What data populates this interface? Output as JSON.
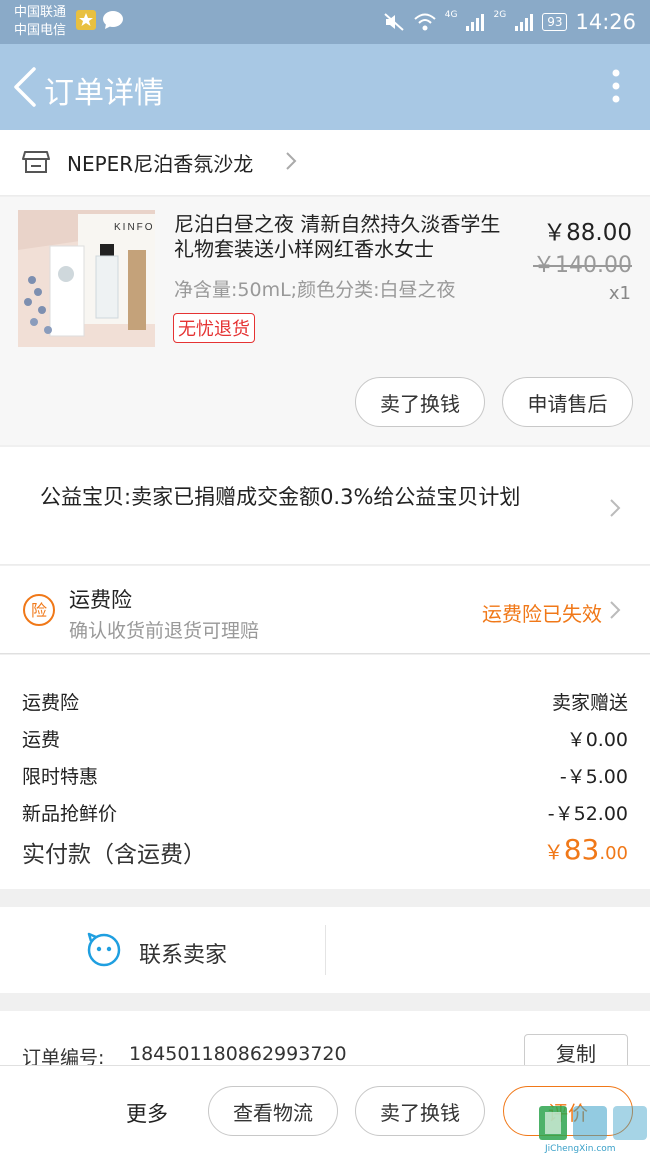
{
  "status_bar": {
    "carrier_1": "中国联通",
    "carrier_2": "中国电信",
    "network_1": "4G",
    "network_2": "2G",
    "battery": "93",
    "time": "14:26"
  },
  "nav": {
    "title": "订单详情"
  },
  "shop": {
    "name": "NEPER尼泊香氛沙龙"
  },
  "item": {
    "title": "尼泊白昼之夜 清新自然持久淡香学生礼物套装送小样网红香水女士",
    "spec": "净含量:50mL;颜色分类:白昼之夜",
    "badge": "无忧退货",
    "price": "￥88.00",
    "original_price": "￥140.00",
    "quantity": "x1",
    "thumbnail_text": "KINFO",
    "actions": [
      "卖了换钱",
      "申请售后"
    ]
  },
  "charity": {
    "text": "公益宝贝:卖家已捐赠成交金额0.3%给公益宝贝计划"
  },
  "shipping_insurance": {
    "icon_char": "险",
    "title": "运费险",
    "subtitle": "确认收货前退货可理赔",
    "status": "运费险已失效"
  },
  "fees": [
    {
      "label": "运费险",
      "value": "卖家赠送"
    },
    {
      "label": "运费",
      "value": "￥0.00"
    },
    {
      "label": "限时特惠",
      "value": "-￥5.00"
    },
    {
      "label": "新品抢鲜价",
      "value": "-￥52.00"
    }
  ],
  "total": {
    "label": "实付款（含运费）",
    "currency": "￥",
    "integer": "83",
    "decimal": ".00"
  },
  "contact": {
    "label": "联系卖家"
  },
  "order": {
    "label": "订单编号:",
    "number": "184501180862993720",
    "copy_label": "复制"
  },
  "bottom_bar": {
    "more": "更多",
    "track": "查看物流",
    "sell": "卖了换钱",
    "rate": "评价"
  },
  "watermark": {
    "text": "JiChengXin.com"
  },
  "colors": {
    "status_bar": "#8aaac8",
    "nav_bar": "#a8c8e4",
    "accent_orange": "#f07818",
    "badge_red": "#e53333"
  }
}
